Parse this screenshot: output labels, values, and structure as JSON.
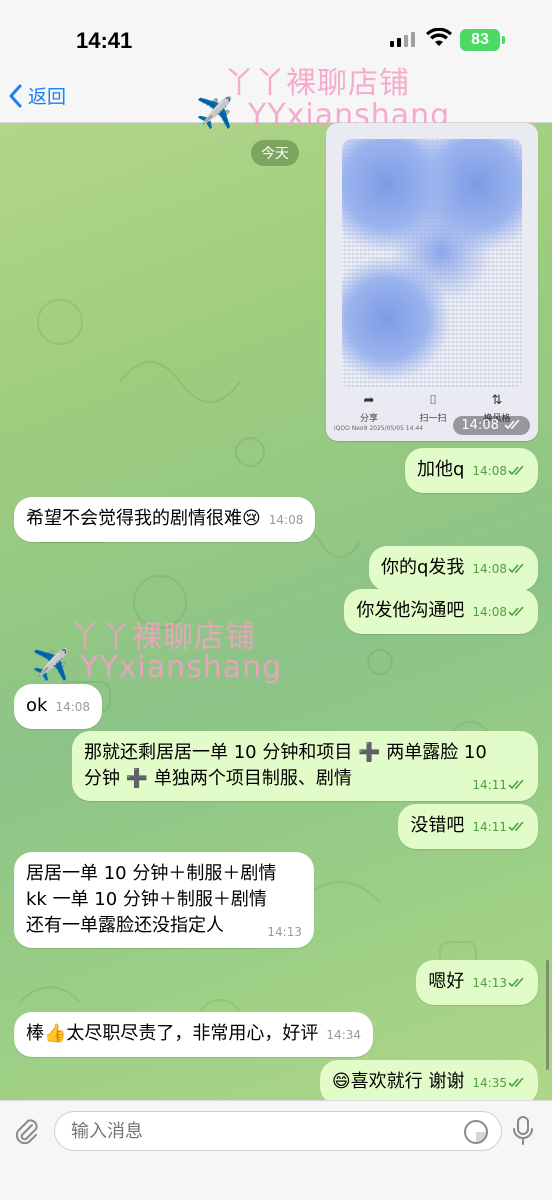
{
  "status_bar": {
    "time": "14:41",
    "battery": "83"
  },
  "nav": {
    "back_label": "返回"
  },
  "watermark": {
    "line1": "丫丫裸聊店铺",
    "line2": "YYxianshang",
    "emoji": "✈️"
  },
  "date_separator": "今天",
  "image_message": {
    "time": "14:08",
    "tools": [
      "分享",
      "扫一扫",
      "换风格"
    ],
    "caption": "iQOO Neo9 2025/05/05 14:44"
  },
  "messages": [
    {
      "dir": "out",
      "text": "加他q",
      "time": "14:08"
    },
    {
      "dir": "in",
      "text": "希望不会觉得我的剧情很难😢",
      "time": "14:08"
    },
    {
      "dir": "out",
      "text": "你的q发我",
      "time": "14:08"
    },
    {
      "dir": "out",
      "text": "你发他沟通吧",
      "time": "14:08"
    },
    {
      "dir": "in",
      "text": "ok",
      "time": "14:08"
    },
    {
      "dir": "out",
      "text_lines": [
        "那就还剩居居一单 10 分钟和项目 ➕ 两单露脸 10",
        "分钟 ➕ 单独两个项目制服、剧情"
      ],
      "time": "14:11"
    },
    {
      "dir": "out",
      "text": "没错吧",
      "time": "14:11"
    },
    {
      "dir": "in",
      "text_lines": [
        "居居一单 10 分钟＋制服＋剧情",
        "kk 一单 10 分钟＋制服＋剧情",
        "还有一单露脸还没指定人"
      ],
      "time": "14:13"
    },
    {
      "dir": "out",
      "text": "嗯好",
      "time": "14:13"
    },
    {
      "dir": "in",
      "text": "棒👍太尽职尽责了，非常用心，好评",
      "time": "14:34"
    },
    {
      "dir": "out",
      "text": "😄喜欢就行  谢谢",
      "time": "14:35"
    }
  ],
  "composer": {
    "placeholder": "输入消息"
  },
  "colors": {
    "accent": "#1e7ff0",
    "outgoing": "#e2fcc9",
    "incoming": "#ffffff",
    "check": "#4ea03e"
  }
}
